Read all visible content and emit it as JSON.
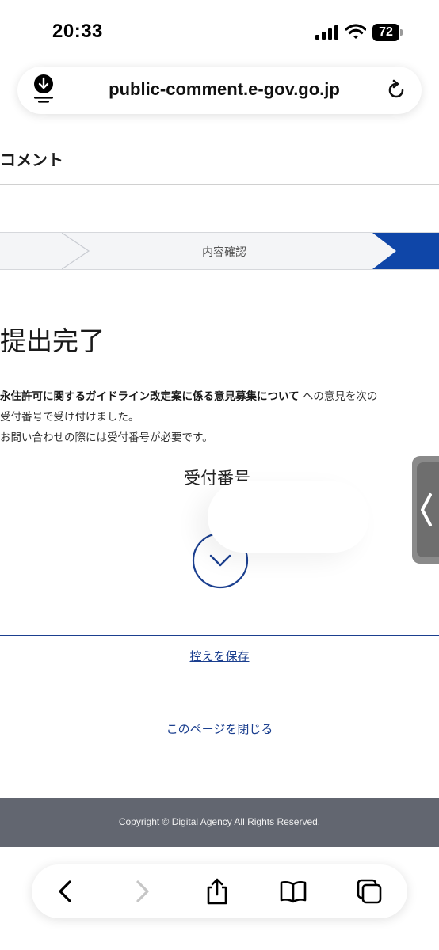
{
  "status_bar": {
    "time": "20:33",
    "battery_level": "72",
    "icons": [
      "signal-icon",
      "wifi-icon",
      "battery-icon"
    ]
  },
  "address_bar": {
    "url": "public-comment.e-gov.go.jp",
    "icons": [
      "download-icon",
      "reload-icon"
    ]
  },
  "page": {
    "header_title": "コメント",
    "step_current_label": "内容確認",
    "complete_title": "提出完了",
    "message": {
      "bold": "永住許可に関するガイドライン改定案に係る意見募集について",
      "line1_rest": " への意見を次の",
      "line2": "受付番号で受け付けました。",
      "line3": "お問い合わせの際には受付番号が必要です。"
    },
    "receipt_label": "受付番号",
    "save_link": "控えを保存",
    "close_link": "このページを閉じる"
  },
  "footer": {
    "copyright": "Copyright © Digital Agency All Rights Reserved."
  },
  "toolbar": {
    "icons": [
      "back-icon",
      "forward-icon",
      "share-icon",
      "bookmarks-icon",
      "tabs-icon"
    ]
  },
  "colors": {
    "accent": "#1b3f8f",
    "step_active": "#0f46a8",
    "footer_bg": "#626670"
  }
}
